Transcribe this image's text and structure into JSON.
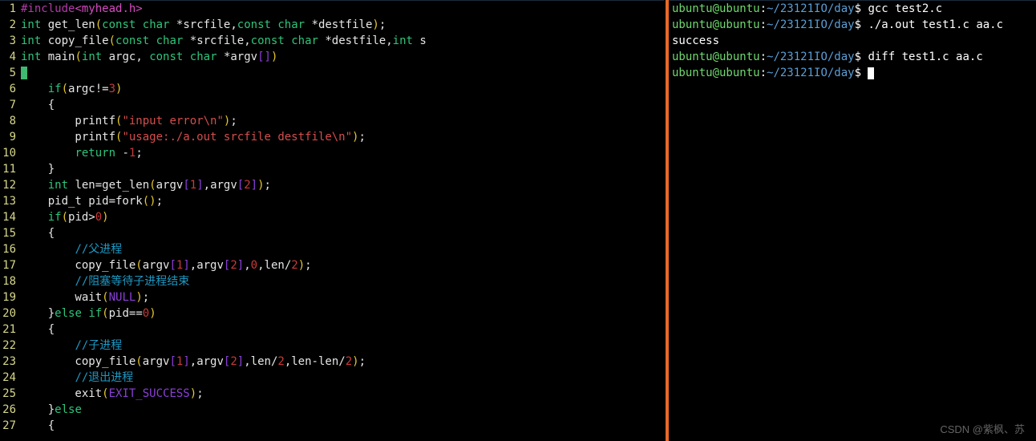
{
  "editor": {
    "lines": [
      {
        "n": 1,
        "kind": "code",
        "tokens": [
          [
            "preproc",
            "#include"
          ],
          [
            "header",
            "<myhead.h>"
          ]
        ]
      },
      {
        "n": 2,
        "kind": "code",
        "tokens": [
          [
            "kw",
            "int"
          ],
          [
            "id",
            " get_len"
          ],
          [
            "paren",
            "("
          ],
          [
            "kw",
            "const"
          ],
          [
            "id",
            " "
          ],
          [
            "kw",
            "char"
          ],
          [
            "id",
            " *srcfile,"
          ],
          [
            "kw",
            "const"
          ],
          [
            "id",
            " "
          ],
          [
            "kw",
            "char"
          ],
          [
            "id",
            " *destfile"
          ],
          [
            "paren",
            ")"
          ],
          [
            "id",
            ";"
          ]
        ]
      },
      {
        "n": 3,
        "kind": "code",
        "tokens": [
          [
            "kw",
            "int"
          ],
          [
            "id",
            " copy_file"
          ],
          [
            "paren",
            "("
          ],
          [
            "kw",
            "const"
          ],
          [
            "id",
            " "
          ],
          [
            "kw",
            "char"
          ],
          [
            "id",
            " *srcfile,"
          ],
          [
            "kw",
            "const"
          ],
          [
            "id",
            " "
          ],
          [
            "kw",
            "char"
          ],
          [
            "id",
            " *destfile,"
          ],
          [
            "kw",
            "int"
          ],
          [
            "id",
            " s"
          ]
        ]
      },
      {
        "n": 4,
        "kind": "code",
        "tokens": [
          [
            "kw",
            "int"
          ],
          [
            "id",
            " main"
          ],
          [
            "paren",
            "("
          ],
          [
            "kw",
            "int"
          ],
          [
            "id",
            " argc, "
          ],
          [
            "kw",
            "const"
          ],
          [
            "id",
            " "
          ],
          [
            "kw",
            "char"
          ],
          [
            "id",
            " *argv"
          ],
          [
            "brack",
            "[]"
          ],
          [
            "paren",
            ")"
          ]
        ]
      },
      {
        "n": 5,
        "kind": "cursor"
      },
      {
        "n": 6,
        "kind": "code",
        "tokens": [
          [
            "id",
            "    "
          ],
          [
            "kw",
            "if"
          ],
          [
            "paren",
            "("
          ],
          [
            "id",
            "argc!="
          ],
          [
            "num",
            "3"
          ],
          [
            "paren",
            ")"
          ]
        ]
      },
      {
        "n": 7,
        "kind": "code",
        "tokens": [
          [
            "id",
            "    "
          ],
          [
            "brace",
            "{"
          ]
        ]
      },
      {
        "n": 8,
        "kind": "code",
        "tokens": [
          [
            "id",
            "        printf"
          ],
          [
            "paren",
            "("
          ],
          [
            "str",
            "\"input error\\n\""
          ],
          [
            "paren",
            ")"
          ],
          [
            "id",
            ";"
          ]
        ]
      },
      {
        "n": 9,
        "kind": "code",
        "tokens": [
          [
            "id",
            "        printf"
          ],
          [
            "paren",
            "("
          ],
          [
            "str",
            "\"usage:./a.out srcfile destfile\\n\""
          ],
          [
            "paren",
            ")"
          ],
          [
            "id",
            ";"
          ]
        ]
      },
      {
        "n": 10,
        "kind": "code",
        "tokens": [
          [
            "id",
            "        "
          ],
          [
            "kw",
            "return"
          ],
          [
            "id",
            " -"
          ],
          [
            "num",
            "1"
          ],
          [
            "id",
            ";"
          ]
        ]
      },
      {
        "n": 11,
        "kind": "code",
        "tokens": [
          [
            "id",
            "    "
          ],
          [
            "brace",
            "}"
          ]
        ]
      },
      {
        "n": 12,
        "kind": "code",
        "tokens": [
          [
            "id",
            "    "
          ],
          [
            "kw",
            "int"
          ],
          [
            "id",
            " len=get_len"
          ],
          [
            "paren",
            "("
          ],
          [
            "id",
            "argv"
          ],
          [
            "brack",
            "["
          ],
          [
            "num",
            "1"
          ],
          [
            "brack",
            "]"
          ],
          [
            "id",
            ",argv"
          ],
          [
            "brack",
            "["
          ],
          [
            "num",
            "2"
          ],
          [
            "brack",
            "]"
          ],
          [
            "paren",
            ")"
          ],
          [
            "id",
            ";"
          ]
        ]
      },
      {
        "n": 13,
        "kind": "code",
        "tokens": [
          [
            "id",
            "    pid_t pid=fork"
          ],
          [
            "paren",
            "()"
          ],
          [
            "id",
            ";"
          ]
        ]
      },
      {
        "n": 14,
        "kind": "code",
        "tokens": [
          [
            "id",
            "    "
          ],
          [
            "kw",
            "if"
          ],
          [
            "paren",
            "("
          ],
          [
            "id",
            "pid>"
          ],
          [
            "num",
            "0"
          ],
          [
            "paren",
            ")"
          ]
        ]
      },
      {
        "n": 15,
        "kind": "code",
        "tokens": [
          [
            "id",
            "    "
          ],
          [
            "brace",
            "{"
          ]
        ]
      },
      {
        "n": 16,
        "kind": "code",
        "tokens": [
          [
            "id",
            "        "
          ],
          [
            "comment",
            "//父进程"
          ]
        ]
      },
      {
        "n": 17,
        "kind": "code",
        "tokens": [
          [
            "id",
            "        copy_file"
          ],
          [
            "paren",
            "("
          ],
          [
            "id",
            "argv"
          ],
          [
            "brack",
            "["
          ],
          [
            "num",
            "1"
          ],
          [
            "brack",
            "]"
          ],
          [
            "id",
            ",argv"
          ],
          [
            "brack",
            "["
          ],
          [
            "num",
            "2"
          ],
          [
            "brack",
            "]"
          ],
          [
            "id",
            ","
          ],
          [
            "num",
            "0"
          ],
          [
            "id",
            ",len/"
          ],
          [
            "num",
            "2"
          ],
          [
            "paren",
            ")"
          ],
          [
            "id",
            ";"
          ]
        ]
      },
      {
        "n": 18,
        "kind": "code",
        "tokens": [
          [
            "id",
            "        "
          ],
          [
            "comment",
            "//阻塞等待子进程结束"
          ]
        ]
      },
      {
        "n": 19,
        "kind": "code",
        "tokens": [
          [
            "id",
            "        wait"
          ],
          [
            "paren",
            "("
          ],
          [
            "const",
            "NULL"
          ],
          [
            "paren",
            ")"
          ],
          [
            "id",
            ";"
          ]
        ]
      },
      {
        "n": 20,
        "kind": "code",
        "tokens": [
          [
            "id",
            "    "
          ],
          [
            "brace",
            "}"
          ],
          [
            "kw",
            "else"
          ],
          [
            "id",
            " "
          ],
          [
            "kw",
            "if"
          ],
          [
            "paren",
            "("
          ],
          [
            "id",
            "pid=="
          ],
          [
            "num",
            "0"
          ],
          [
            "paren",
            ")"
          ]
        ]
      },
      {
        "n": 21,
        "kind": "code",
        "tokens": [
          [
            "id",
            "    "
          ],
          [
            "brace",
            "{"
          ]
        ]
      },
      {
        "n": 22,
        "kind": "code",
        "tokens": [
          [
            "id",
            "        "
          ],
          [
            "comment",
            "//子进程"
          ]
        ]
      },
      {
        "n": 23,
        "kind": "code",
        "tokens": [
          [
            "id",
            "        copy_file"
          ],
          [
            "paren",
            "("
          ],
          [
            "id",
            "argv"
          ],
          [
            "brack",
            "["
          ],
          [
            "num",
            "1"
          ],
          [
            "brack",
            "]"
          ],
          [
            "id",
            ",argv"
          ],
          [
            "brack",
            "["
          ],
          [
            "num",
            "2"
          ],
          [
            "brack",
            "]"
          ],
          [
            "id",
            ",len/"
          ],
          [
            "num",
            "2"
          ],
          [
            "id",
            ",len-len/"
          ],
          [
            "num",
            "2"
          ],
          [
            "paren",
            ")"
          ],
          [
            "id",
            ";"
          ]
        ]
      },
      {
        "n": 24,
        "kind": "code",
        "tokens": [
          [
            "id",
            "        "
          ],
          [
            "comment",
            "//退出进程"
          ]
        ]
      },
      {
        "n": 25,
        "kind": "code",
        "tokens": [
          [
            "id",
            "        exit"
          ],
          [
            "paren",
            "("
          ],
          [
            "const",
            "EXIT_SUCCESS"
          ],
          [
            "paren",
            ")"
          ],
          [
            "id",
            ";"
          ]
        ]
      },
      {
        "n": 26,
        "kind": "code",
        "tokens": [
          [
            "id",
            "    "
          ],
          [
            "brace",
            "}"
          ],
          [
            "kw",
            "else"
          ]
        ]
      },
      {
        "n": 27,
        "kind": "code",
        "tokens": [
          [
            "id",
            "    "
          ],
          [
            "brace",
            "{"
          ]
        ]
      }
    ]
  },
  "terminal": {
    "prompt": {
      "user": "ubuntu@ubuntu",
      "sep": ":",
      "path": "~/23121IO/day",
      "dollar": "$"
    },
    "lines": [
      {
        "type": "cmd",
        "text": "gcc test2.c"
      },
      {
        "type": "cmd",
        "text": "./a.out test1.c aa.c"
      },
      {
        "type": "out",
        "text": "success"
      },
      {
        "type": "cmd",
        "text": "diff test1.c aa.c"
      },
      {
        "type": "cmd",
        "text": "",
        "cursor": true
      }
    ]
  },
  "watermark": "CSDN @紫枫、苏"
}
